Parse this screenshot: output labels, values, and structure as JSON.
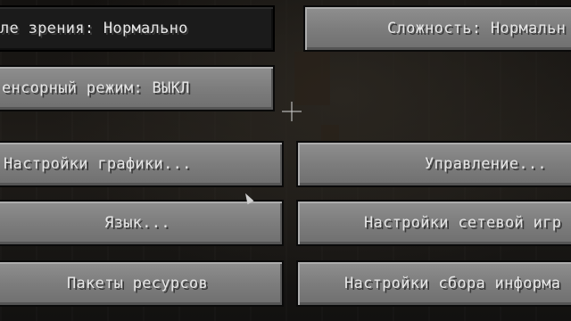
{
  "options": {
    "fov_effects": "ле зрения: Нормально",
    "difficulty": "Сложность: Нормальн",
    "touchscreen": "енсорный режим: ВЫКЛ",
    "video_settings": "Настройки графики...",
    "controls": "Управление...",
    "language": "Язык...",
    "multiplayer_settings": "Настройки сетевой игр",
    "resource_packs": "Пакеты ресурсов",
    "snooper_settings": "Настройки сбора информа"
  }
}
